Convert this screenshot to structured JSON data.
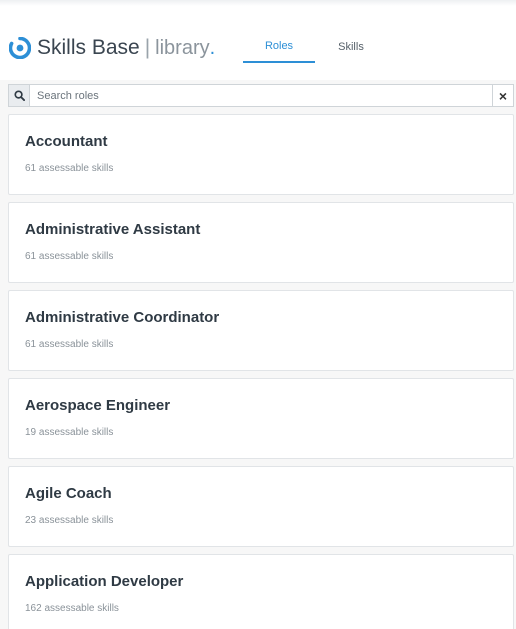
{
  "header": {
    "brand": "Skills Base",
    "separator": "|",
    "product": "library",
    "product_dot": ".",
    "brand_color": "#2d8fd6",
    "logo_icon": "skills-base-logo-icon"
  },
  "tabs": [
    {
      "label": "Roles",
      "active": true
    },
    {
      "label": "Skills",
      "active": false
    }
  ],
  "search": {
    "placeholder": "Search roles",
    "value": "",
    "search_icon": "search-icon",
    "clear_label": "×"
  },
  "roles": [
    {
      "title": "Accountant",
      "meta": "61 assessable skills"
    },
    {
      "title": "Administrative Assistant",
      "meta": "61 assessable skills"
    },
    {
      "title": "Administrative Coordinator",
      "meta": "61 assessable skills"
    },
    {
      "title": "Aerospace Engineer",
      "meta": "19 assessable skills"
    },
    {
      "title": "Agile Coach",
      "meta": "23 assessable skills"
    },
    {
      "title": "Application Developer",
      "meta": "162 assessable skills"
    }
  ]
}
